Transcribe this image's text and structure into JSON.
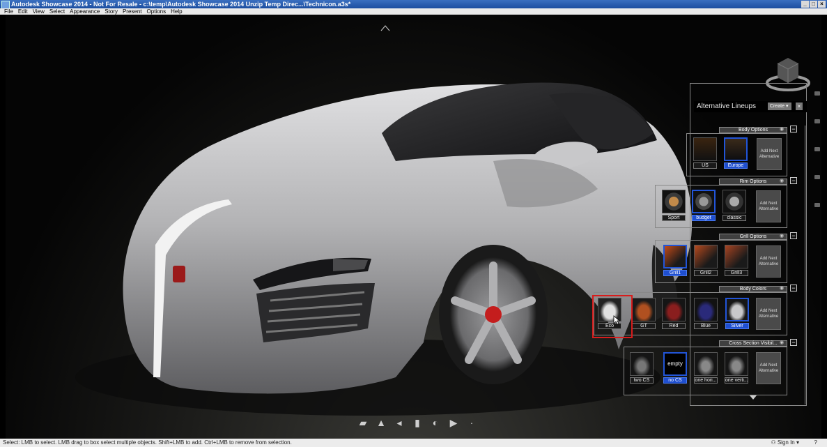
{
  "window": {
    "title": "Autodesk Showcase 2014 - Not For Resale - c:\\temp\\Autodesk Showcase 2014 Unzip Temp Direc...\\Technicon.a3s*",
    "min": "_",
    "max": "□",
    "close": "×"
  },
  "menu": [
    "File",
    "Edit",
    "View",
    "Select",
    "Appearance",
    "Story",
    "Present",
    "Options",
    "Help"
  ],
  "panel": {
    "title": "Alternative Lineups",
    "create_label": "Create",
    "close_label": "×",
    "add_next_label": "Add Next Alternative",
    "groups": [
      {
        "title": "Body Options",
        "items": [
          "US",
          "Europe"
        ],
        "selected": "Europe"
      },
      {
        "title": "Rim Options",
        "items": [
          "Sport",
          "budget",
          "classic"
        ],
        "selected": "budget"
      },
      {
        "title": "Grill Options",
        "items": [
          "Grill1",
          "Grill2",
          "Grill3"
        ],
        "selected": "Grill1"
      },
      {
        "title": "Body Colors",
        "items": [
          "Eco",
          "GT",
          "Red",
          "Blue",
          "Silver"
        ],
        "selected": "Silver"
      },
      {
        "title": "Cross Section Visibil...",
        "items": [
          "two CS",
          "no CS",
          "one hori...",
          "one verti..."
        ],
        "selected": "no CS",
        "empty_label": "empty"
      }
    ]
  },
  "status": {
    "text": "Select: LMB to select. LMB drag to box select multiple objects. Shift+LMB to add. Ctrl+LMB to remove from selection.",
    "sign_in": "Sign In"
  },
  "colors": {
    "selection": "#1f4fd0",
    "highlight": "#d81c1c",
    "car_body": "#b9b9bb",
    "title_bar": "#1c4ea0"
  }
}
